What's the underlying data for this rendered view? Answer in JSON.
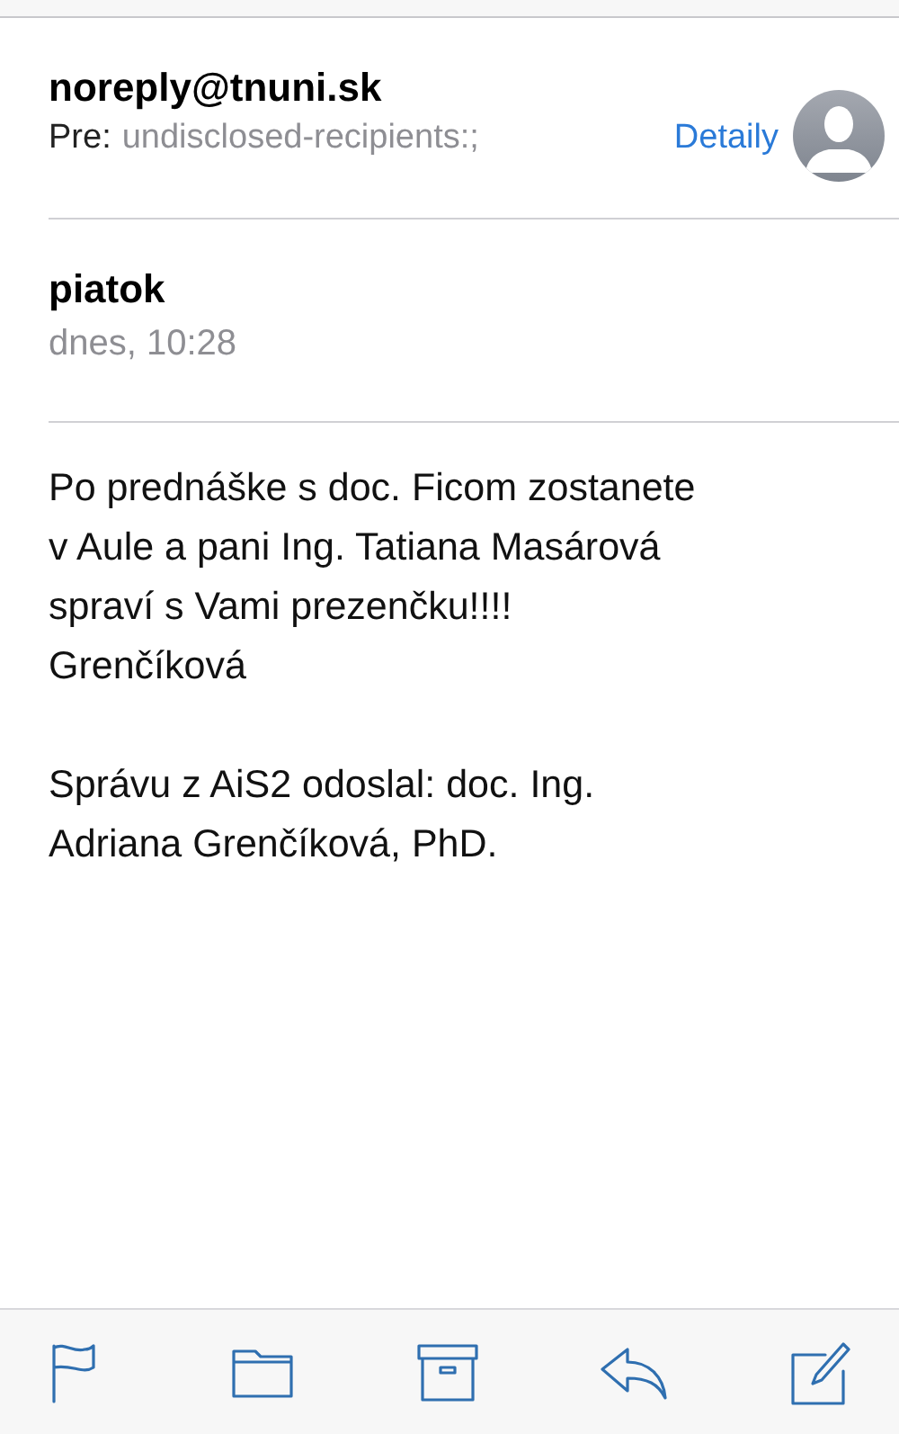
{
  "message": {
    "sender": "noreply@tnuni.sk",
    "to_label": "Pre:",
    "recipients": "undisclosed-recipients:;",
    "details_link": "Detaily",
    "day": "piatok",
    "time": "dnes, 10:28"
  },
  "body": [
    {
      "lines": [
        "Po prednáške s doc. Ficom zostanete",
        "v Aule a pani Ing. Tatiana Masárová",
        "spraví s Vami prezenčku!!!!",
        "Grenčíková"
      ]
    },
    {
      "lines": [
        "Správu z AiS2 odoslal: doc. Ing.",
        "Adriana Grenčíková, PhD."
      ]
    }
  ],
  "toolbar": [
    {
      "kind": "flag"
    },
    {
      "kind": "folder"
    },
    {
      "kind": "archive"
    },
    {
      "kind": "reply"
    },
    {
      "kind": "compose"
    }
  ]
}
